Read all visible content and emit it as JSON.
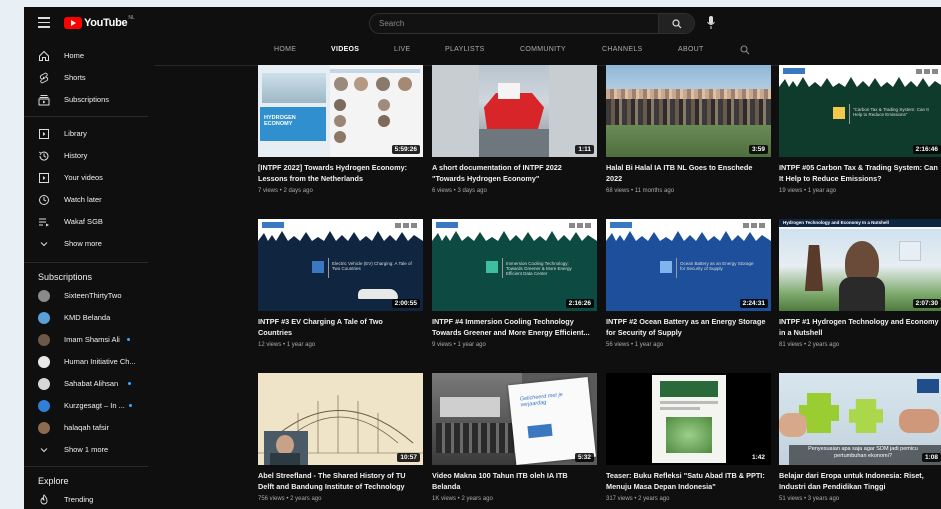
{
  "header": {
    "logo_text": "YouTube",
    "logo_country": "NL",
    "search_placeholder": "Search"
  },
  "tabs": [
    {
      "label": "HOME",
      "active": false
    },
    {
      "label": "VIDEOS",
      "active": true
    },
    {
      "label": "LIVE",
      "active": false
    },
    {
      "label": "PLAYLISTS",
      "active": false
    },
    {
      "label": "COMMUNITY",
      "active": false
    },
    {
      "label": "CHANNELS",
      "active": false
    },
    {
      "label": "ABOUT",
      "active": false
    }
  ],
  "sidebar": {
    "main": [
      {
        "label": "Home",
        "icon": "home-icon"
      },
      {
        "label": "Shorts",
        "icon": "shorts-icon"
      },
      {
        "label": "Subscriptions",
        "icon": "subscriptions-icon"
      }
    ],
    "library": [
      {
        "label": "Library",
        "icon": "library-icon"
      },
      {
        "label": "History",
        "icon": "history-icon"
      },
      {
        "label": "Your videos",
        "icon": "your-videos-icon"
      },
      {
        "label": "Watch later",
        "icon": "watch-later-icon"
      },
      {
        "label": "Wakaf SGB",
        "icon": "playlist-icon"
      },
      {
        "label": "Show more",
        "icon": "chevron-down-icon"
      }
    ],
    "subscriptions_heading": "Subscriptions",
    "subscriptions": [
      {
        "label": "SixteenThirtyTwo",
        "color": "#8a8a8a",
        "live": false
      },
      {
        "label": "KMD Belanda",
        "color": "#5aa0d8",
        "live": false
      },
      {
        "label": "Imam Shamsi Ali",
        "color": "#6b5848",
        "live": true
      },
      {
        "label": "Human Initiative Ch...",
        "color": "#e8e8e8",
        "live": false
      },
      {
        "label": "Sahabat Alihsan",
        "color": "#d8d8d8",
        "live": true
      },
      {
        "label": "Kurzgesagt – In ...",
        "color": "#2f7fd6",
        "live": true
      },
      {
        "label": "halaqah tafsir",
        "color": "#8a6a50",
        "live": false
      }
    ],
    "show_more_subs": "Show 1 more",
    "explore_heading": "Explore",
    "explore": [
      {
        "label": "Trending",
        "icon": "trending-icon"
      }
    ]
  },
  "videos": [
    {
      "title": "[INTPF 2022] Towards Hydrogen Economy: Lessons from the Netherlands",
      "meta": "7 views • 2 days ago",
      "duration": "5:59:26",
      "thumb": "hydrogen",
      "thumb_text": "HYDROGEN ECONOMY"
    },
    {
      "title": "A short documentation of INTPF 2022 \"Towards Hydrogen Economy\"",
      "meta": "6 views • 3 days ago",
      "duration": "1:11",
      "thumb": "ship",
      "thumb_text": ""
    },
    {
      "title": "Halal Bi Halal IA ITB NL Goes to Enschede 2022",
      "meta": "68 views • 11 months ago",
      "duration": "3:59",
      "thumb": "group",
      "thumb_text": ""
    },
    {
      "title": "INTPF #05 Carbon Tax & Trading System: Can It Help to Reduce Emissions?",
      "meta": "19 views • 1 year ago",
      "duration": "2:16:46",
      "thumb": "green",
      "thumb_text": "\"Carbon Tax & Trading System: Can It Help to Reduce Emissions\""
    },
    {
      "title": "INTPF #3 EV Charging A Tale of Two Countries",
      "meta": "12 views • 1 year ago",
      "duration": "2:00:55",
      "thumb": "navy",
      "thumb_text": "Electric Vehicle (EV) Charging: A Tale of Two Countries"
    },
    {
      "title": "INTPF #4 Immersion Cooling Technology Towards Greener and More Energy Efficient...",
      "meta": "9 views • 1 year ago",
      "duration": "2:16:26",
      "thumb": "teal",
      "thumb_text": "Immersion Cooling Technology: Towards Greener & More Energy Efficient Data Center"
    },
    {
      "title": "INTPF #2 Ocean Battery as an Energy Storage for Security of Supply",
      "meta": "56 views • 1 year ago",
      "duration": "2:24:31",
      "thumb": "blue",
      "thumb_text": "Ocean Battery as an Energy Storage for Security of Supply"
    },
    {
      "title": "INTPF #1 Hydrogen Technology and Economy in a Nutshell",
      "meta": "81 views • 2 years ago",
      "duration": "2:07:30",
      "thumb": "person",
      "thumb_text": "Hydrogen Technology and Economy In a Nutshell"
    },
    {
      "title": "Abel Streefland - The Shared History of TU Delft and Bandung Institute of Technology",
      "meta": "756 views • 2 years ago",
      "duration": "10:57",
      "thumb": "sketch",
      "thumb_text": ""
    },
    {
      "title": "Video Makna 100 Tahun ITB oleh IA ITB Belanda",
      "meta": "1K views • 2 years ago",
      "duration": "5:32",
      "thumb": "hall",
      "thumb_text": "Gelicheerd met je verjaardag"
    },
    {
      "title": "Teaser: Buku Refleksi \"Satu Abad ITB & PPTI: Menuju Masa Depan Indonesia\"",
      "meta": "317 views • 2 years ago",
      "duration": "1:42",
      "thumb": "book",
      "thumb_text": ""
    },
    {
      "title": "Belajar dari Eropa untuk Indonesia: Riset, Industri dan Pendidikan Tinggi",
      "meta": "51 views • 3 years ago",
      "duration": "1:08",
      "thumb": "puzzle",
      "thumb_text": "Penyesuaian apa saja agar SDM jadi pemicu pertumbuhan ekonomi?"
    }
  ]
}
